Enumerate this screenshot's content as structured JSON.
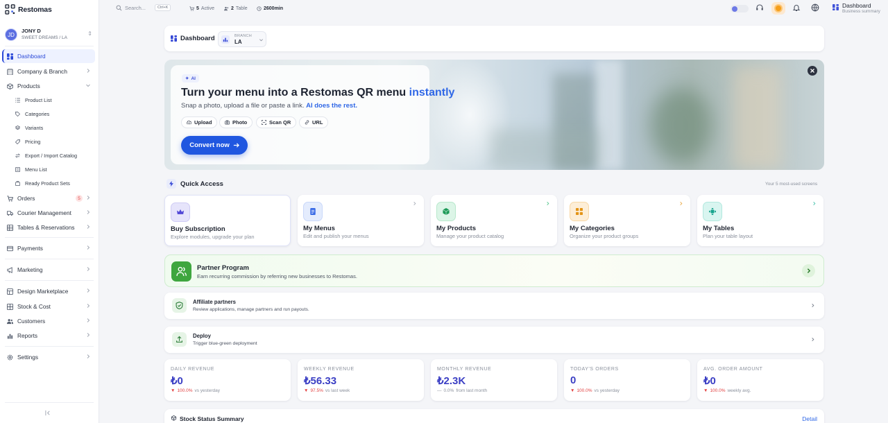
{
  "app": {
    "logo_text": "Restomas",
    "colors": {
      "accent": "#2a49d8",
      "primary_button": "#2057e0",
      "highlight": "#2f67e6",
      "success": "#3fa63f",
      "danger": "#e24040"
    }
  },
  "user": {
    "initials": "JD",
    "name": "JONY D",
    "subtitle": "SWEET DREAMS / LA"
  },
  "sidebar": {
    "items": [
      {
        "label": "Dashboard",
        "icon": "dashboard-icon",
        "active": true
      },
      {
        "label": "Company & Branch",
        "icon": "building-icon"
      },
      {
        "label": "Products",
        "icon": "box-icon",
        "expanded": true
      }
    ],
    "product_subitems": [
      {
        "label": "Product List",
        "icon": "list-icon"
      },
      {
        "label": "Categories",
        "icon": "tag-icon"
      },
      {
        "label": "Variants",
        "icon": "layers-icon"
      },
      {
        "label": "Pricing",
        "icon": "price-tag-icon"
      },
      {
        "label": "Export / Import Catalog",
        "icon": "transfer-icon"
      },
      {
        "label": "Menu List",
        "icon": "menu-icon"
      },
      {
        "label": "Ready Product Sets",
        "icon": "package-icon"
      }
    ],
    "items2": [
      {
        "label": "Orders",
        "icon": "cart-icon",
        "badge": "5"
      },
      {
        "label": "Courier Management",
        "icon": "truck-icon"
      },
      {
        "label": "Tables & Reservations",
        "icon": "table-icon"
      },
      {
        "label": "Payments",
        "icon": "card-icon"
      },
      {
        "label": "Marketing",
        "icon": "megaphone-icon"
      },
      {
        "label": "Design Marketplace",
        "icon": "palette-icon"
      },
      {
        "label": "Stock & Cost",
        "icon": "stock-icon"
      },
      {
        "label": "Customers",
        "icon": "users-icon"
      },
      {
        "label": "Reports",
        "icon": "chart-icon"
      },
      {
        "label": "Settings",
        "icon": "gear-icon"
      }
    ]
  },
  "topbar": {
    "search_placeholder": "Search...",
    "shortcut": "Ctrl+K",
    "stats": [
      {
        "value": "5",
        "label": "Active",
        "icon": "cart-icon"
      },
      {
        "value": "2",
        "label": "Table",
        "icon": "users-icon"
      },
      {
        "value": "2600min",
        "label": "",
        "icon": "clock-icon"
      }
    ],
    "page_title": "Dashboard",
    "page_subtitle": "Business summary"
  },
  "header": {
    "title": "Dashboard",
    "branch_label": "BRANCH",
    "branch_value": "LA"
  },
  "hero": {
    "chip": "AI",
    "title_main": "Turn your menu into a Restomas QR menu",
    "title_highlight": "instantly",
    "subtitle_main": "Snap a photo, upload a file or paste a link.",
    "subtitle_highlight": "AI does the rest.",
    "options": [
      "Upload",
      "Photo",
      "Scan QR",
      "URL"
    ],
    "cta": "Convert now"
  },
  "quick_access": {
    "title": "Quick Access",
    "note": "Your 5 most-used screens",
    "cards": [
      {
        "title": "Buy Subscription",
        "subtitle": "Explore modules, upgrade your plan",
        "icon": "crown-icon"
      },
      {
        "title": "My Menus",
        "subtitle": "Edit and publish your menus",
        "icon": "document-icon"
      },
      {
        "title": "My Products",
        "subtitle": "Manage your product catalog",
        "icon": "cube-icon"
      },
      {
        "title": "My Categories",
        "subtitle": "Organize your product groups",
        "icon": "grid-icon"
      },
      {
        "title": "My Tables",
        "subtitle": "Plan your table layout",
        "icon": "table-icon"
      }
    ]
  },
  "partner": {
    "title": "Partner Program",
    "subtitle": "Earn recurring commission by referring new businesses to Restomas."
  },
  "affiliate": {
    "title": "Affiliate partners",
    "subtitle": "Review applications, manage partners and run payouts."
  },
  "deploy": {
    "title": "Deploy",
    "subtitle": "Trigger blue-green deployment"
  },
  "stats": [
    {
      "label": "DAILY REVENUE",
      "value": "₺0",
      "delta": "100.0%",
      "trend": "down",
      "compare": "vs yesterday"
    },
    {
      "label": "WEEKLY REVENUE",
      "value": "₺56.33",
      "delta": "97.5%",
      "trend": "down",
      "compare": "vs last week"
    },
    {
      "label": "MONTHLY REVENUE",
      "value": "₺2.3K",
      "delta": "0.0%",
      "trend": "flat",
      "compare": "from last month"
    },
    {
      "label": "TODAY'S ORDERS",
      "value": "0",
      "delta": "100.0%",
      "trend": "down",
      "compare": "vs yesterday"
    },
    {
      "label": "AVG. ORDER AMOUNT",
      "value": "₺0",
      "delta": "100.0%",
      "trend": "down",
      "compare": "weekly avg."
    }
  ],
  "stock": {
    "title": "Stock Status Summary",
    "link": "Detail"
  }
}
